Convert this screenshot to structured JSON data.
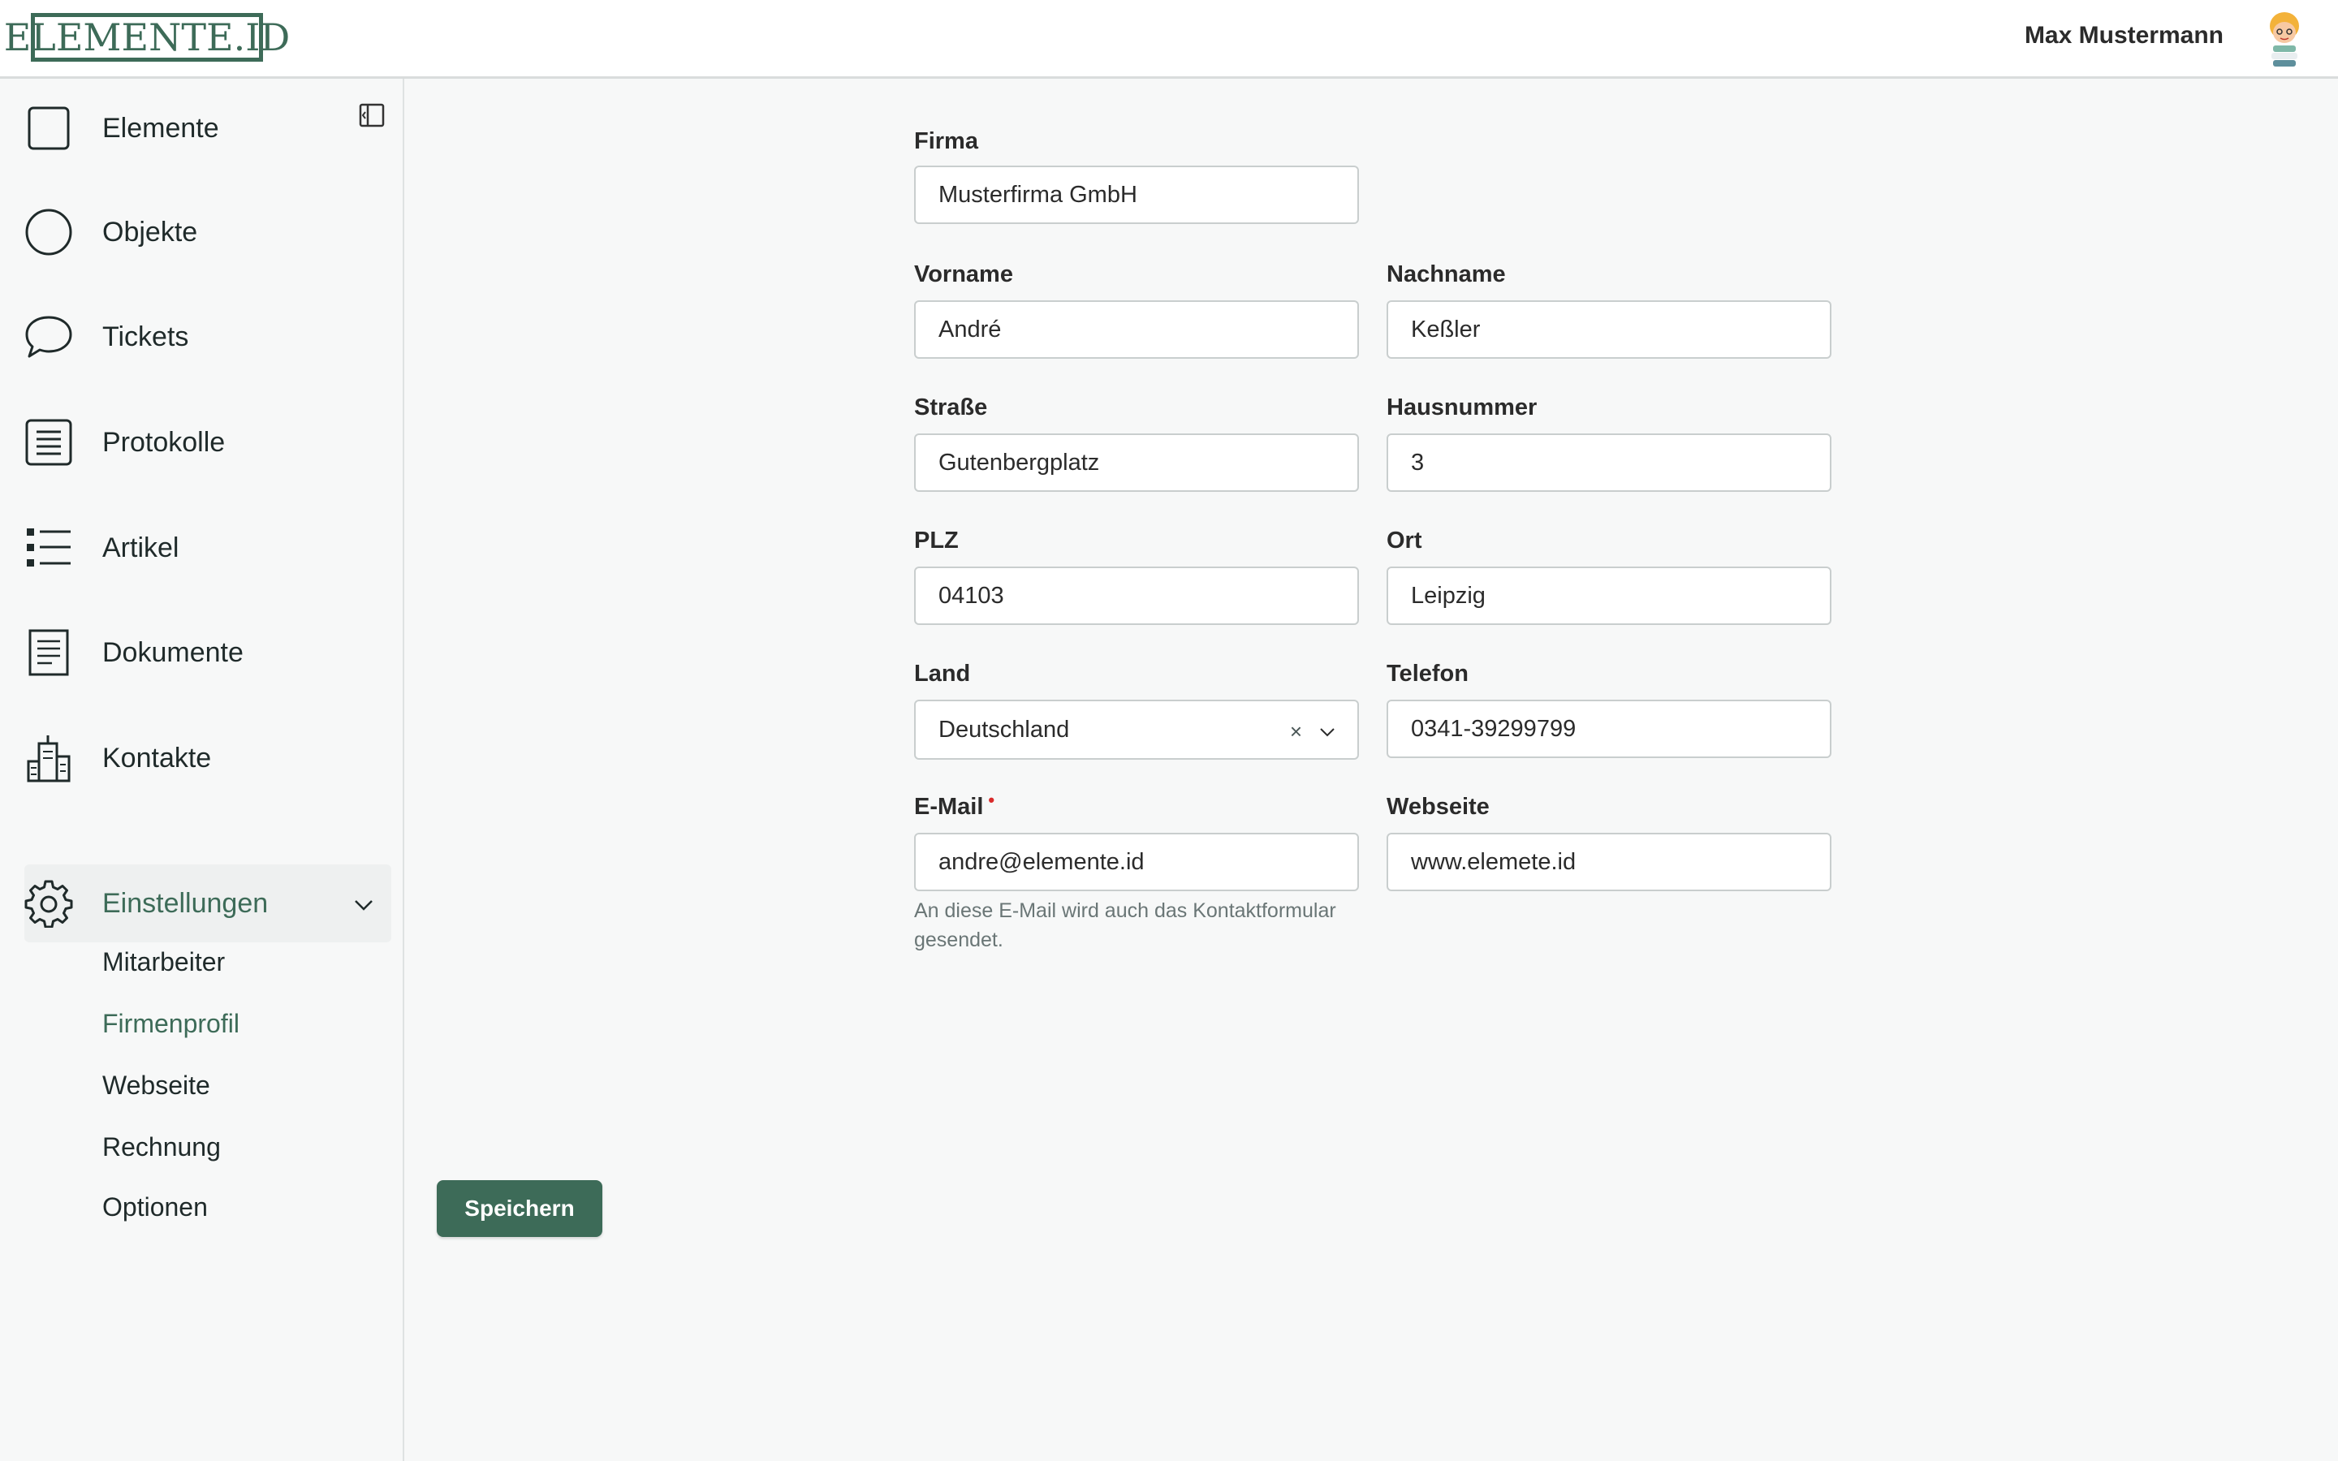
{
  "header": {
    "logo_text": "ELEMENTE.ID",
    "user_name": "Max Mustermann"
  },
  "sidebar": {
    "items": [
      {
        "label": "Elemente",
        "icon": "square-icon"
      },
      {
        "label": "Objekte",
        "icon": "circle-icon"
      },
      {
        "label": "Tickets",
        "icon": "chat-bubble-icon"
      },
      {
        "label": "Protokolle",
        "icon": "protocol-document-icon"
      },
      {
        "label": "Artikel",
        "icon": "list-icon"
      },
      {
        "label": "Dokumente",
        "icon": "document-icon"
      },
      {
        "label": "Kontakte",
        "icon": "buildings-icon"
      },
      {
        "label": "Einstellungen",
        "icon": "gear-icon",
        "active": true
      }
    ],
    "sub_items": [
      {
        "label": "Mitarbeiter"
      },
      {
        "label": "Firmenprofil",
        "active": true
      },
      {
        "label": "Webseite"
      },
      {
        "label": "Rechnung"
      },
      {
        "label": "Optionen"
      }
    ]
  },
  "form": {
    "firma": {
      "label": "Firma",
      "value": "Musterfirma GmbH"
    },
    "vorname": {
      "label": "Vorname",
      "value": "André"
    },
    "nachname": {
      "label": "Nachname",
      "value": "Keßler"
    },
    "strasse": {
      "label": "Straße",
      "value": "Gutenbergplatz"
    },
    "hausnummer": {
      "label": "Hausnummer",
      "value": "3"
    },
    "plz": {
      "label": "PLZ",
      "value": "04103"
    },
    "ort": {
      "label": "Ort",
      "value": "Leipzig"
    },
    "land": {
      "label": "Land",
      "value": "Deutschland",
      "clear": "×"
    },
    "telefon": {
      "label": "Telefon",
      "value": "0341-39299799"
    },
    "email": {
      "label": "E-Mail",
      "required_mark": "•",
      "value": "andre@elemente.id",
      "hint": "An diese E-Mail wird auch das Kontaktformular gesendet."
    },
    "webseite": {
      "label": "Webseite",
      "value": "www.elemete.id"
    }
  },
  "actions": {
    "save_label": "Speichern"
  },
  "colors": {
    "brand": "#3d6b58",
    "required": "#d92b2b"
  }
}
